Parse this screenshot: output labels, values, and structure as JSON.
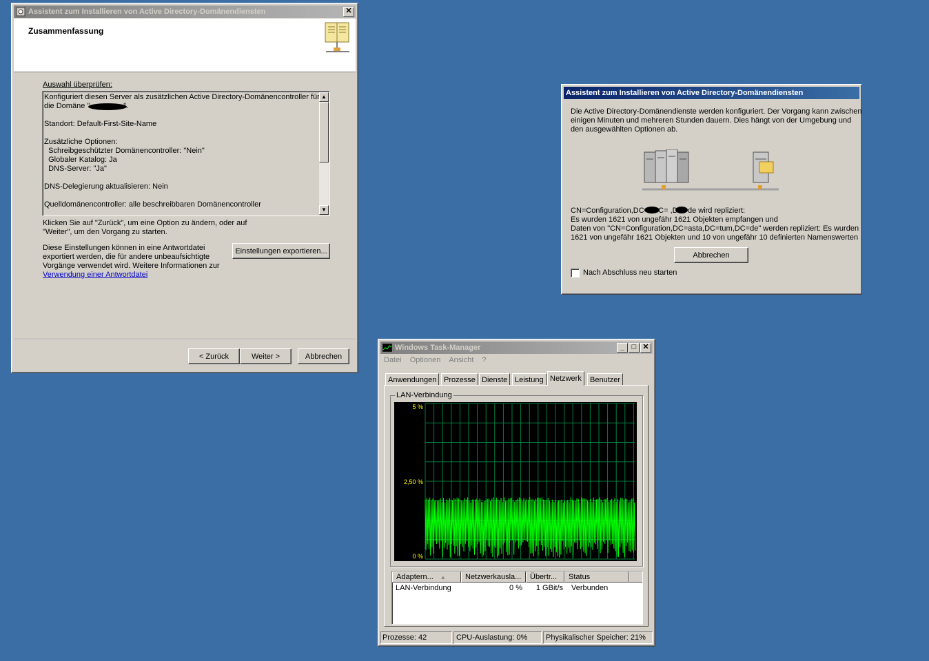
{
  "wizard": {
    "title": "Assistent zum Installieren von Active Directory-Domänendiensten",
    "heading": "Zusammenfassung",
    "review_label": "Auswahl überprüfen:",
    "summary_lines": [
      "Konfiguriert diesen Server als zusätzlichen Active Directory-Domänencontroller für",
      "die Domäne \"                \".",
      "",
      "Standort: Default-First-Site-Name",
      "",
      "Zusätzliche Optionen:",
      "  Schreibgeschützter Domänencontroller: \"Nein\"",
      "  Globaler Katalog: Ja",
      "  DNS-Server: \"Ja\"",
      "",
      "DNS-Delegierung aktualisieren: Nein",
      "",
      "Quelldomänencontroller: alle beschreibbaren Domänencontroller"
    ],
    "back_hint_1": "Klicken Sie auf \"Zurück\", um eine Option zu ändern, oder auf",
    "back_hint_2": "\"Weiter\", um den Vorgang zu starten.",
    "export_text_1": "Diese Einstellungen können in eine Antwortdatei",
    "export_text_2": "exportiert werden, die für andere unbeaufsichtigte",
    "export_text_3": "Vorgänge verwendet wird. Weitere Informationen zur",
    "export_link": "Verwendung einer Antwortdatei",
    "export_button": "Einstellungen exportieren...",
    "back_button": "< Zurück",
    "next_button": "Weiter >",
    "cancel_button": "Abbrechen",
    "close_glyph": "✕"
  },
  "progress": {
    "title": "Assistent zum Installieren von Active Directory-Domänendiensten",
    "intro_1": "Die Active Directory-Domänendienste werden konfiguriert. Der Vorgang kann zwischen",
    "intro_2": "einigen Minuten und mehreren Stunden dauern. Dies hängt von der Umgebung und",
    "intro_3": "den ausgewählten Optionen ab.",
    "status_1": "CN=Configuration,DC=     ,DC=     ,DC=de wird repliziert:",
    "status_2": "Es wurden 1621 von ungefähr 1621 Objekten empfangen und",
    "status_3": "Daten von \"CN=Configuration,DC=asta,DC=tum,DC=de\" werden repliziert: Es wurden",
    "status_4": "1621 von ungefähr 1621 Objekten und 10 von ungefähr 10 definierten Namenswerten",
    "cancel_button": "Abbrechen",
    "restart_checkbox": "Nach Abschluss neu starten",
    "restart_checked": false
  },
  "taskmgr": {
    "title": "Windows Task-Manager",
    "menu": [
      "Datei",
      "Optionen",
      "Ansicht",
      "?"
    ],
    "tabs": [
      "Anwendungen",
      "Prozesse",
      "Dienste",
      "Leistung",
      "Netzwerk",
      "Benutzer"
    ],
    "selected_tab": "Netzwerk",
    "graph_group": "LAN-Verbindung",
    "y_labels": [
      "5 %",
      "2,50 %",
      "0 %"
    ],
    "columns": [
      "Adaptern...",
      "Netzwerkausla...",
      "Übertr...",
      "Status"
    ],
    "rows": [
      {
        "adapter": "LAN-Verbindung",
        "usage": "0 %",
        "speed": "1 GBit/s",
        "status": "Verbunden"
      }
    ],
    "status_processes": "Prozesse: 42",
    "status_cpu": "CPU-Auslastung: 0%",
    "status_mem": "Physikalischer Speicher: 21%",
    "btn_min": "_",
    "btn_max": "□",
    "btn_close": "✕",
    "graph_color": "#00ff00",
    "grid_color": "#008040"
  }
}
